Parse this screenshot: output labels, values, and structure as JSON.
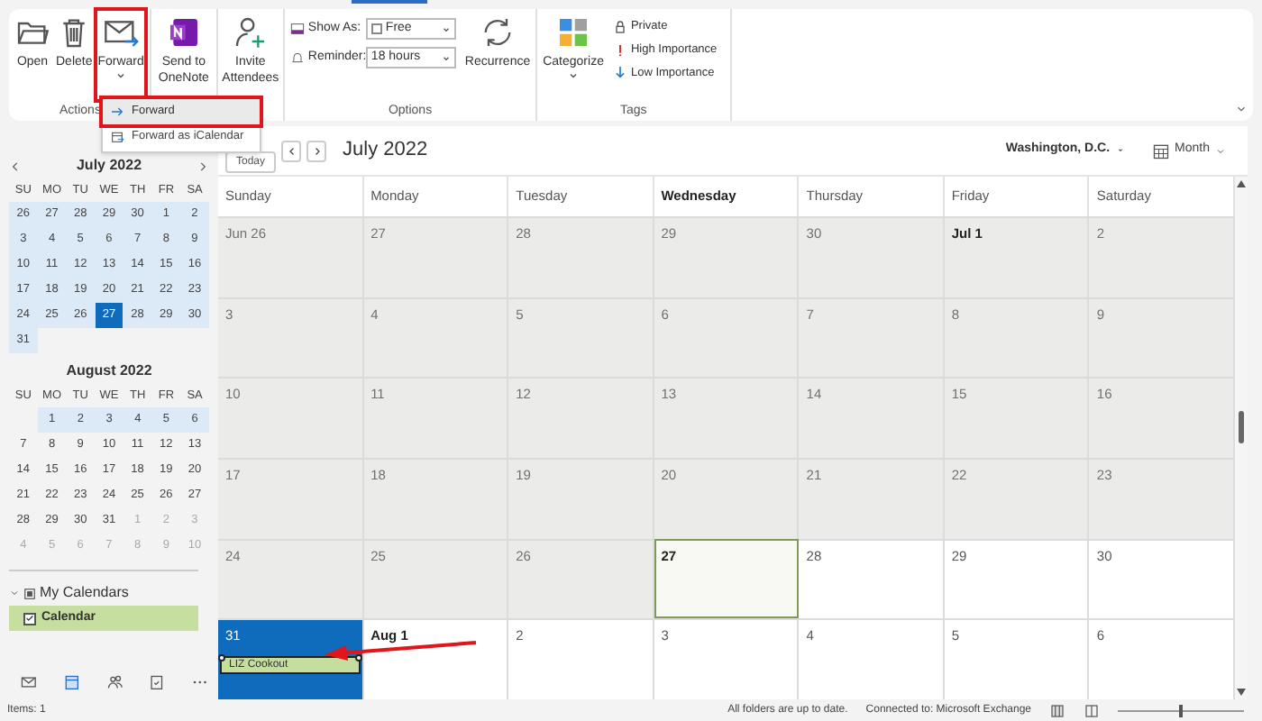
{
  "ribbon": {
    "groups": [
      {
        "label": "Actions",
        "buttons": [
          {
            "label": "Open",
            "caret": false,
            "highlighted": false
          },
          {
            "label": "Delete",
            "caret": false,
            "highlighted": false
          },
          {
            "label": "Forward",
            "caret": true,
            "highlighted": true
          }
        ]
      },
      {
        "buttons": [
          {
            "label": "Send to OneNote",
            "caret": false,
            "highlighted": false
          }
        ]
      },
      {
        "buttons": [
          {
            "label": "Invite Attendees",
            "caret": false,
            "highlighted": false
          }
        ]
      },
      {
        "label": "Options",
        "show_as": {
          "label": "Show As:",
          "value": "Free"
        },
        "reminder": {
          "label": "Reminder:",
          "value": "18 hours"
        },
        "buttons": [
          {
            "label": "Recurrence",
            "caret": false,
            "highlighted": false
          }
        ]
      },
      {
        "label": "Tags",
        "buttons": [
          {
            "label": "Categorize",
            "caret": true,
            "highlighted": false
          }
        ],
        "tags": [
          "Private",
          "High Importance",
          "Low Importance"
        ]
      }
    ]
  },
  "forward_menu": {
    "items": [
      {
        "label": "Forward",
        "selected": true,
        "highlighted": true
      },
      {
        "label": "Forward as iCalendar",
        "selected": false,
        "highlighted": false
      }
    ]
  },
  "mini_calendars": [
    {
      "title": "July 2022",
      "weekdays": [
        "SU",
        "MO",
        "TU",
        "WE",
        "TH",
        "FR",
        "SA"
      ],
      "weeks": [
        {
          "in_view": true,
          "align_end": false,
          "days": [
            {
              "d": "26",
              "dim": false,
              "selected": false
            },
            {
              "d": "27",
              "dim": false,
              "selected": false
            },
            {
              "d": "28",
              "dim": false,
              "selected": false
            },
            {
              "d": "29",
              "dim": false,
              "selected": false
            },
            {
              "d": "30",
              "dim": false,
              "selected": false
            },
            {
              "d": "1",
              "dim": false,
              "selected": false
            },
            {
              "d": "2",
              "dim": false,
              "selected": false
            }
          ]
        },
        {
          "in_view": true,
          "align_end": false,
          "days": [
            {
              "d": "3",
              "dim": false,
              "selected": false
            },
            {
              "d": "4",
              "dim": false,
              "selected": false
            },
            {
              "d": "5",
              "dim": false,
              "selected": false
            },
            {
              "d": "6",
              "dim": false,
              "selected": false
            },
            {
              "d": "7",
              "dim": false,
              "selected": false
            },
            {
              "d": "8",
              "dim": false,
              "selected": false
            },
            {
              "d": "9",
              "dim": false,
              "selected": false
            }
          ]
        },
        {
          "in_view": true,
          "align_end": false,
          "days": [
            {
              "d": "10",
              "dim": false,
              "selected": false
            },
            {
              "d": "11",
              "dim": false,
              "selected": false
            },
            {
              "d": "12",
              "dim": false,
              "selected": false
            },
            {
              "d": "13",
              "dim": false,
              "selected": false
            },
            {
              "d": "14",
              "dim": false,
              "selected": false
            },
            {
              "d": "15",
              "dim": false,
              "selected": false
            },
            {
              "d": "16",
              "dim": false,
              "selected": false
            }
          ]
        },
        {
          "in_view": true,
          "align_end": false,
          "days": [
            {
              "d": "17",
              "dim": false,
              "selected": false
            },
            {
              "d": "18",
              "dim": false,
              "selected": false
            },
            {
              "d": "19",
              "dim": false,
              "selected": false
            },
            {
              "d": "20",
              "dim": false,
              "selected": false
            },
            {
              "d": "21",
              "dim": false,
              "selected": false
            },
            {
              "d": "22",
              "dim": false,
              "selected": false
            },
            {
              "d": "23",
              "dim": false,
              "selected": false
            }
          ]
        },
        {
          "in_view": true,
          "align_end": false,
          "days": [
            {
              "d": "24",
              "dim": false,
              "selected": false
            },
            {
              "d": "25",
              "dim": false,
              "selected": false
            },
            {
              "d": "26",
              "dim": false,
              "selected": false
            },
            {
              "d": "27",
              "dim": false,
              "selected": true
            },
            {
              "d": "28",
              "dim": false,
              "selected": false
            },
            {
              "d": "29",
              "dim": false,
              "selected": false
            },
            {
              "d": "30",
              "dim": false,
              "selected": false
            }
          ]
        },
        {
          "in_view": true,
          "align_end": false,
          "days": [
            {
              "d": "31",
              "dim": false,
              "selected": false
            }
          ]
        }
      ]
    },
    {
      "title": "August 2022",
      "weekdays": [
        "SU",
        "MO",
        "TU",
        "WE",
        "TH",
        "FR",
        "SA"
      ],
      "weeks": [
        {
          "in_view": true,
          "align_end": true,
          "days": [
            {
              "d": "1",
              "dim": false,
              "selected": false
            },
            {
              "d": "2",
              "dim": false,
              "selected": false
            },
            {
              "d": "3",
              "dim": false,
              "selected": false
            },
            {
              "d": "4",
              "dim": false,
              "selected": false
            },
            {
              "d": "5",
              "dim": false,
              "selected": false
            },
            {
              "d": "6",
              "dim": false,
              "selected": false
            }
          ]
        },
        {
          "in_view": false,
          "align_end": false,
          "days": [
            {
              "d": "7",
              "dim": false,
              "selected": false
            },
            {
              "d": "8",
              "dim": false,
              "selected": false
            },
            {
              "d": "9",
              "dim": false,
              "selected": false
            },
            {
              "d": "10",
              "dim": false,
              "selected": false
            },
            {
              "d": "11",
              "dim": false,
              "selected": false
            },
            {
              "d": "12",
              "dim": false,
              "selected": false
            },
            {
              "d": "13",
              "dim": false,
              "selected": false
            }
          ]
        },
        {
          "in_view": false,
          "align_end": false,
          "days": [
            {
              "d": "14",
              "dim": false,
              "selected": false
            },
            {
              "d": "15",
              "dim": false,
              "selected": false
            },
            {
              "d": "16",
              "dim": false,
              "selected": false
            },
            {
              "d": "17",
              "dim": false,
              "selected": false
            },
            {
              "d": "18",
              "dim": false,
              "selected": false
            },
            {
              "d": "19",
              "dim": false,
              "selected": false
            },
            {
              "d": "20",
              "dim": false,
              "selected": false
            }
          ]
        },
        {
          "in_view": false,
          "align_end": false,
          "days": [
            {
              "d": "21",
              "dim": false,
              "selected": false
            },
            {
              "d": "22",
              "dim": false,
              "selected": false
            },
            {
              "d": "23",
              "dim": false,
              "selected": false
            },
            {
              "d": "24",
              "dim": false,
              "selected": false
            },
            {
              "d": "25",
              "dim": false,
              "selected": false
            },
            {
              "d": "26",
              "dim": false,
              "selected": false
            },
            {
              "d": "27",
              "dim": false,
              "selected": false
            }
          ]
        },
        {
          "in_view": false,
          "align_end": false,
          "days": [
            {
              "d": "28",
              "dim": false,
              "selected": false
            },
            {
              "d": "29",
              "dim": false,
              "selected": false
            },
            {
              "d": "30",
              "dim": false,
              "selected": false
            },
            {
              "d": "31",
              "dim": false,
              "selected": false
            },
            {
              "d": "1",
              "dim": true,
              "selected": false
            },
            {
              "d": "2",
              "dim": true,
              "selected": false
            },
            {
              "d": "3",
              "dim": true,
              "selected": false
            }
          ]
        },
        {
          "in_view": false,
          "align_end": false,
          "days": [
            {
              "d": "4",
              "dim": true,
              "selected": false
            },
            {
              "d": "5",
              "dim": true,
              "selected": false
            },
            {
              "d": "6",
              "dim": true,
              "selected": false
            },
            {
              "d": "7",
              "dim": true,
              "selected": false
            },
            {
              "d": "8",
              "dim": true,
              "selected": false
            },
            {
              "d": "9",
              "dim": true,
              "selected": false
            },
            {
              "d": "10",
              "dim": true,
              "selected": false
            }
          ]
        }
      ]
    }
  ],
  "folders": {
    "group": {
      "label": "My Calendars",
      "expanded": true
    },
    "items": [
      {
        "label": "Calendar",
        "checked": true,
        "color": "#c6dfa0"
      }
    ]
  },
  "toolbar": {
    "today": "Today",
    "title": "July 2022",
    "location": "Washington, D.C.",
    "view": "Month"
  },
  "calendar": {
    "weekdays": [
      {
        "label": "Sunday",
        "today": false
      },
      {
        "label": "Monday",
        "today": false
      },
      {
        "label": "Tuesday",
        "today": false
      },
      {
        "label": "Wednesday",
        "today": true
      },
      {
        "label": "Thursday",
        "today": false
      },
      {
        "label": "Friday",
        "today": false
      },
      {
        "label": "Saturday",
        "today": false
      }
    ],
    "weeks": [
      [
        {
          "date": "Jun 26",
          "past": true,
          "today": false,
          "selected": false,
          "bold": false
        },
        {
          "date": "27",
          "past": true,
          "today": false,
          "selected": false,
          "bold": false
        },
        {
          "date": "28",
          "past": true,
          "today": false,
          "selected": false,
          "bold": false
        },
        {
          "date": "29",
          "past": true,
          "today": false,
          "selected": false,
          "bold": false
        },
        {
          "date": "30",
          "past": true,
          "today": false,
          "selected": false,
          "bold": false
        },
        {
          "date": "Jul 1",
          "past": true,
          "today": false,
          "selected": false,
          "bold": true
        },
        {
          "date": "2",
          "past": true,
          "today": false,
          "selected": false,
          "bold": false
        }
      ],
      [
        {
          "date": "3",
          "past": true,
          "today": false,
          "selected": false,
          "bold": false
        },
        {
          "date": "4",
          "past": true,
          "today": false,
          "selected": false,
          "bold": false
        },
        {
          "date": "5",
          "past": true,
          "today": false,
          "selected": false,
          "bold": false
        },
        {
          "date": "6",
          "past": true,
          "today": false,
          "selected": false,
          "bold": false
        },
        {
          "date": "7",
          "past": true,
          "today": false,
          "selected": false,
          "bold": false
        },
        {
          "date": "8",
          "past": true,
          "today": false,
          "selected": false,
          "bold": false
        },
        {
          "date": "9",
          "past": true,
          "today": false,
          "selected": false,
          "bold": false
        }
      ],
      [
        {
          "date": "10",
          "past": true,
          "today": false,
          "selected": false,
          "bold": false
        },
        {
          "date": "11",
          "past": true,
          "today": false,
          "selected": false,
          "bold": false
        },
        {
          "date": "12",
          "past": true,
          "today": false,
          "selected": false,
          "bold": false
        },
        {
          "date": "13",
          "past": true,
          "today": false,
          "selected": false,
          "bold": false
        },
        {
          "date": "14",
          "past": true,
          "today": false,
          "selected": false,
          "bold": false
        },
        {
          "date": "15",
          "past": true,
          "today": false,
          "selected": false,
          "bold": false
        },
        {
          "date": "16",
          "past": true,
          "today": false,
          "selected": false,
          "bold": false
        }
      ],
      [
        {
          "date": "17",
          "past": true,
          "today": false,
          "selected": false,
          "bold": false
        },
        {
          "date": "18",
          "past": true,
          "today": false,
          "selected": false,
          "bold": false
        },
        {
          "date": "19",
          "past": true,
          "today": false,
          "selected": false,
          "bold": false
        },
        {
          "date": "20",
          "past": true,
          "today": false,
          "selected": false,
          "bold": false
        },
        {
          "date": "21",
          "past": true,
          "today": false,
          "selected": false,
          "bold": false
        },
        {
          "date": "22",
          "past": true,
          "today": false,
          "selected": false,
          "bold": false
        },
        {
          "date": "23",
          "past": true,
          "today": false,
          "selected": false,
          "bold": false
        }
      ],
      [
        {
          "date": "24",
          "past": true,
          "today": false,
          "selected": false,
          "bold": false
        },
        {
          "date": "25",
          "past": true,
          "today": false,
          "selected": false,
          "bold": false
        },
        {
          "date": "26",
          "past": true,
          "today": false,
          "selected": false,
          "bold": false
        },
        {
          "date": "27",
          "past": false,
          "today": true,
          "selected": false,
          "bold": true
        },
        {
          "date": "28",
          "past": false,
          "today": false,
          "selected": false,
          "bold": false
        },
        {
          "date": "29",
          "past": false,
          "today": false,
          "selected": false,
          "bold": false
        },
        {
          "date": "30",
          "past": false,
          "today": false,
          "selected": false,
          "bold": false
        }
      ],
      [
        {
          "date": "31",
          "past": false,
          "today": false,
          "selected": true,
          "bold": false,
          "events": [
            {
              "title": "LIZ Cookout",
              "selected": true
            }
          ]
        },
        {
          "date": "Aug 1",
          "past": false,
          "today": false,
          "selected": false,
          "bold": true
        },
        {
          "date": "2",
          "past": false,
          "today": false,
          "selected": false,
          "bold": false
        },
        {
          "date": "3",
          "past": false,
          "today": false,
          "selected": false,
          "bold": false
        },
        {
          "date": "4",
          "past": false,
          "today": false,
          "selected": false,
          "bold": false
        },
        {
          "date": "5",
          "past": false,
          "today": false,
          "selected": false,
          "bold": false
        },
        {
          "date": "6",
          "past": false,
          "today": false,
          "selected": false,
          "bold": false
        }
      ]
    ]
  },
  "status_bar": {
    "zoom": {
      "level": 0.5
    },
    "items": "Items: 1",
    "sync": "All folders are up to date.",
    "connection": "Connected to: Microsoft Exchange"
  }
}
